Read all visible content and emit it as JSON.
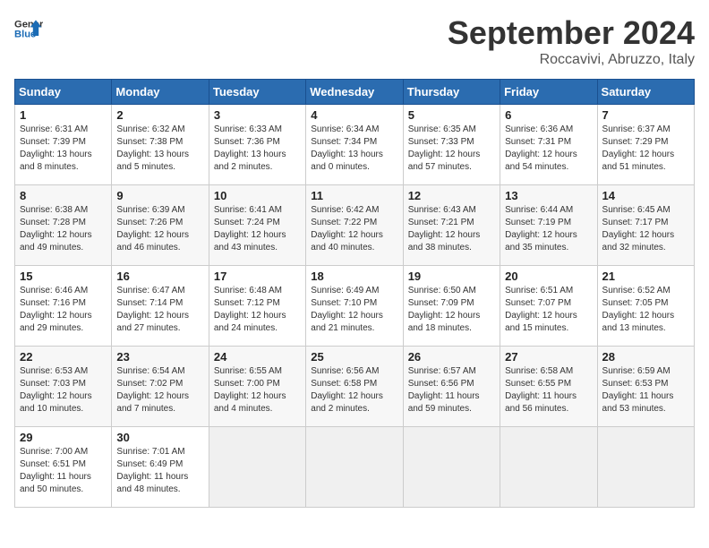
{
  "header": {
    "logo_general": "General",
    "logo_blue": "Blue",
    "month": "September 2024",
    "location": "Roccavivi, Abruzzo, Italy"
  },
  "days_of_week": [
    "Sunday",
    "Monday",
    "Tuesday",
    "Wednesday",
    "Thursday",
    "Friday",
    "Saturday"
  ],
  "weeks": [
    [
      {
        "day": "1",
        "sunrise": "Sunrise: 6:31 AM",
        "sunset": "Sunset: 7:39 PM",
        "daylight": "Daylight: 13 hours and 8 minutes."
      },
      {
        "day": "2",
        "sunrise": "Sunrise: 6:32 AM",
        "sunset": "Sunset: 7:38 PM",
        "daylight": "Daylight: 13 hours and 5 minutes."
      },
      {
        "day": "3",
        "sunrise": "Sunrise: 6:33 AM",
        "sunset": "Sunset: 7:36 PM",
        "daylight": "Daylight: 13 hours and 2 minutes."
      },
      {
        "day": "4",
        "sunrise": "Sunrise: 6:34 AM",
        "sunset": "Sunset: 7:34 PM",
        "daylight": "Daylight: 13 hours and 0 minutes."
      },
      {
        "day": "5",
        "sunrise": "Sunrise: 6:35 AM",
        "sunset": "Sunset: 7:33 PM",
        "daylight": "Daylight: 12 hours and 57 minutes."
      },
      {
        "day": "6",
        "sunrise": "Sunrise: 6:36 AM",
        "sunset": "Sunset: 7:31 PM",
        "daylight": "Daylight: 12 hours and 54 minutes."
      },
      {
        "day": "7",
        "sunrise": "Sunrise: 6:37 AM",
        "sunset": "Sunset: 7:29 PM",
        "daylight": "Daylight: 12 hours and 51 minutes."
      }
    ],
    [
      {
        "day": "8",
        "sunrise": "Sunrise: 6:38 AM",
        "sunset": "Sunset: 7:28 PM",
        "daylight": "Daylight: 12 hours and 49 minutes."
      },
      {
        "day": "9",
        "sunrise": "Sunrise: 6:39 AM",
        "sunset": "Sunset: 7:26 PM",
        "daylight": "Daylight: 12 hours and 46 minutes."
      },
      {
        "day": "10",
        "sunrise": "Sunrise: 6:41 AM",
        "sunset": "Sunset: 7:24 PM",
        "daylight": "Daylight: 12 hours and 43 minutes."
      },
      {
        "day": "11",
        "sunrise": "Sunrise: 6:42 AM",
        "sunset": "Sunset: 7:22 PM",
        "daylight": "Daylight: 12 hours and 40 minutes."
      },
      {
        "day": "12",
        "sunrise": "Sunrise: 6:43 AM",
        "sunset": "Sunset: 7:21 PM",
        "daylight": "Daylight: 12 hours and 38 minutes."
      },
      {
        "day": "13",
        "sunrise": "Sunrise: 6:44 AM",
        "sunset": "Sunset: 7:19 PM",
        "daylight": "Daylight: 12 hours and 35 minutes."
      },
      {
        "day": "14",
        "sunrise": "Sunrise: 6:45 AM",
        "sunset": "Sunset: 7:17 PM",
        "daylight": "Daylight: 12 hours and 32 minutes."
      }
    ],
    [
      {
        "day": "15",
        "sunrise": "Sunrise: 6:46 AM",
        "sunset": "Sunset: 7:16 PM",
        "daylight": "Daylight: 12 hours and 29 minutes."
      },
      {
        "day": "16",
        "sunrise": "Sunrise: 6:47 AM",
        "sunset": "Sunset: 7:14 PM",
        "daylight": "Daylight: 12 hours and 27 minutes."
      },
      {
        "day": "17",
        "sunrise": "Sunrise: 6:48 AM",
        "sunset": "Sunset: 7:12 PM",
        "daylight": "Daylight: 12 hours and 24 minutes."
      },
      {
        "day": "18",
        "sunrise": "Sunrise: 6:49 AM",
        "sunset": "Sunset: 7:10 PM",
        "daylight": "Daylight: 12 hours and 21 minutes."
      },
      {
        "day": "19",
        "sunrise": "Sunrise: 6:50 AM",
        "sunset": "Sunset: 7:09 PM",
        "daylight": "Daylight: 12 hours and 18 minutes."
      },
      {
        "day": "20",
        "sunrise": "Sunrise: 6:51 AM",
        "sunset": "Sunset: 7:07 PM",
        "daylight": "Daylight: 12 hours and 15 minutes."
      },
      {
        "day": "21",
        "sunrise": "Sunrise: 6:52 AM",
        "sunset": "Sunset: 7:05 PM",
        "daylight": "Daylight: 12 hours and 13 minutes."
      }
    ],
    [
      {
        "day": "22",
        "sunrise": "Sunrise: 6:53 AM",
        "sunset": "Sunset: 7:03 PM",
        "daylight": "Daylight: 12 hours and 10 minutes."
      },
      {
        "day": "23",
        "sunrise": "Sunrise: 6:54 AM",
        "sunset": "Sunset: 7:02 PM",
        "daylight": "Daylight: 12 hours and 7 minutes."
      },
      {
        "day": "24",
        "sunrise": "Sunrise: 6:55 AM",
        "sunset": "Sunset: 7:00 PM",
        "daylight": "Daylight: 12 hours and 4 minutes."
      },
      {
        "day": "25",
        "sunrise": "Sunrise: 6:56 AM",
        "sunset": "Sunset: 6:58 PM",
        "daylight": "Daylight: 12 hours and 2 minutes."
      },
      {
        "day": "26",
        "sunrise": "Sunrise: 6:57 AM",
        "sunset": "Sunset: 6:56 PM",
        "daylight": "Daylight: 11 hours and 59 minutes."
      },
      {
        "day": "27",
        "sunrise": "Sunrise: 6:58 AM",
        "sunset": "Sunset: 6:55 PM",
        "daylight": "Daylight: 11 hours and 56 minutes."
      },
      {
        "day": "28",
        "sunrise": "Sunrise: 6:59 AM",
        "sunset": "Sunset: 6:53 PM",
        "daylight": "Daylight: 11 hours and 53 minutes."
      }
    ],
    [
      {
        "day": "29",
        "sunrise": "Sunrise: 7:00 AM",
        "sunset": "Sunset: 6:51 PM",
        "daylight": "Daylight: 11 hours and 50 minutes."
      },
      {
        "day": "30",
        "sunrise": "Sunrise: 7:01 AM",
        "sunset": "Sunset: 6:49 PM",
        "daylight": "Daylight: 11 hours and 48 minutes."
      },
      null,
      null,
      null,
      null,
      null
    ]
  ]
}
